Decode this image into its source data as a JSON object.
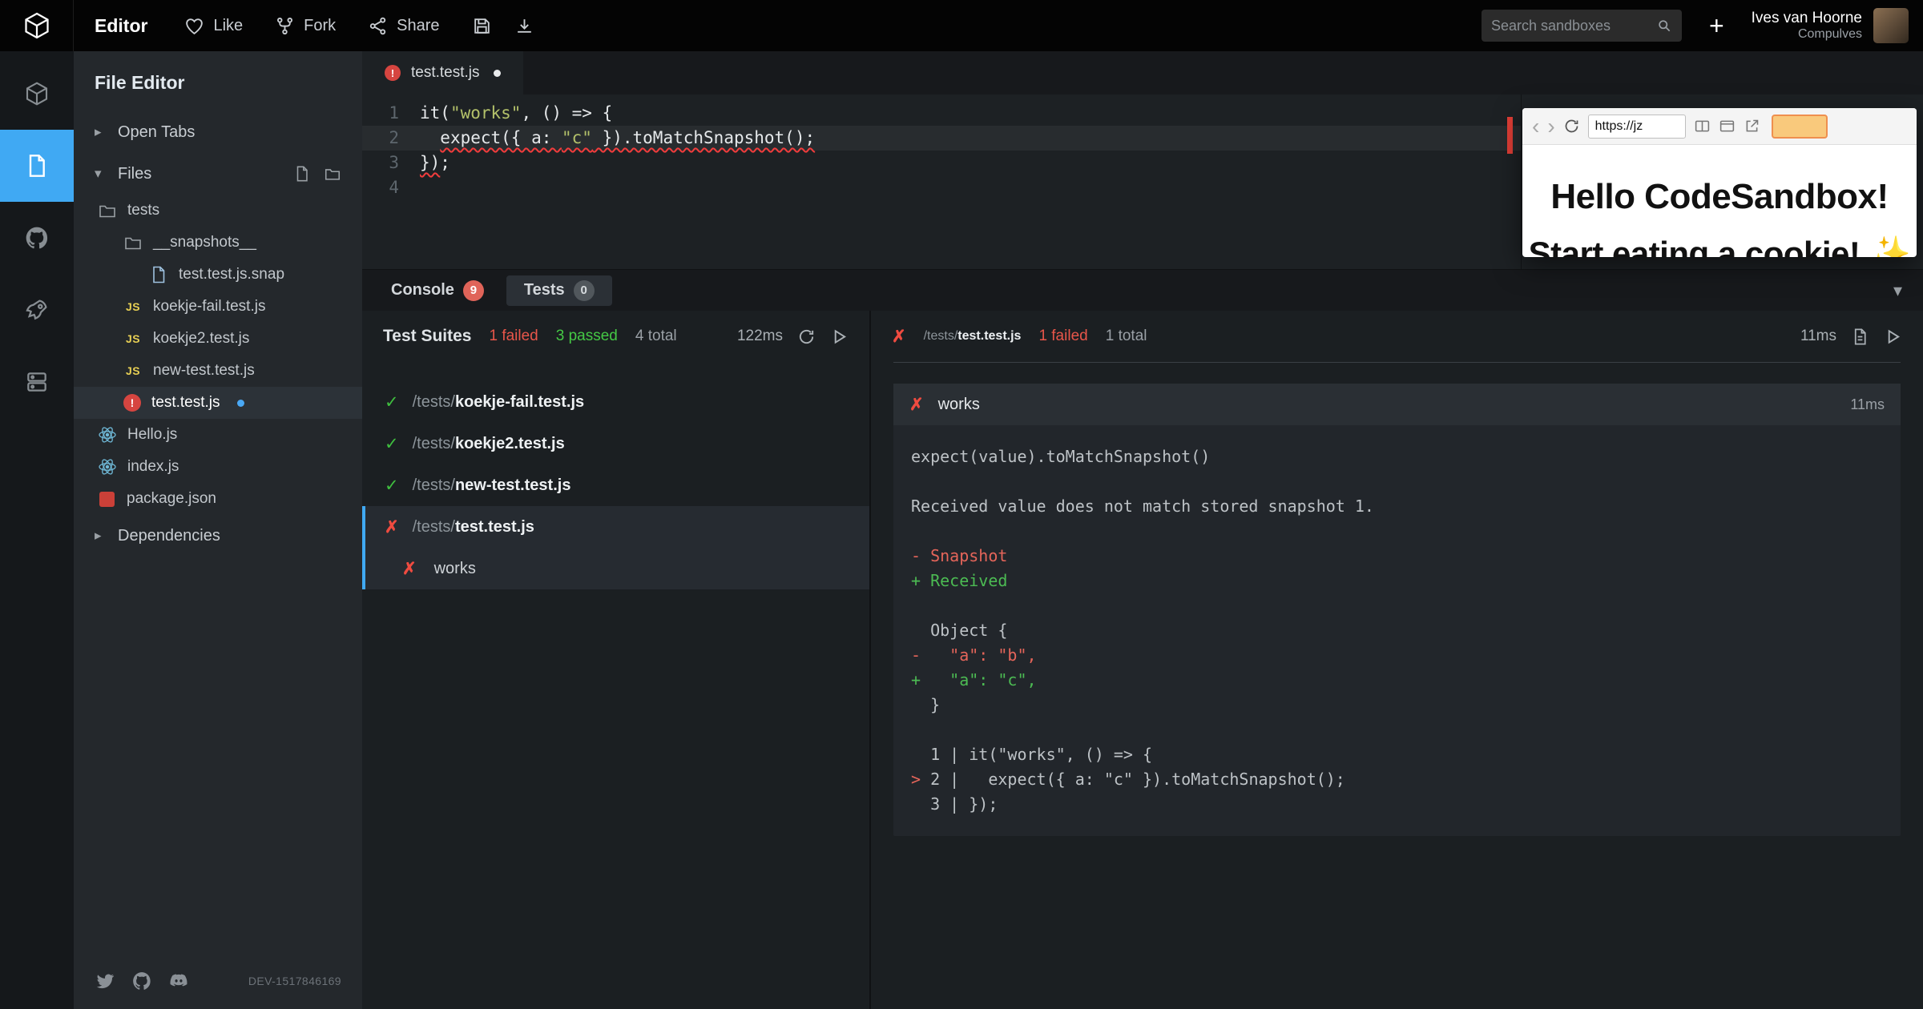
{
  "topbar": {
    "app_title": "Editor",
    "like_label": "Like",
    "fork_label": "Fork",
    "share_label": "Share",
    "search_placeholder": "Search sandboxes",
    "plus_label": "+",
    "user_name": "Ives van Hoorne",
    "user_team": "Compulves"
  },
  "sidebar": {
    "title": "File Editor",
    "open_tabs_label": "Open Tabs",
    "files_label": "Files",
    "dependencies_label": "Dependencies",
    "dev_id": "DEV-1517846169",
    "tree": [
      {
        "label": "tests",
        "icon": "folder",
        "depth": 0
      },
      {
        "label": "__snapshots__",
        "icon": "folder",
        "depth": 1
      },
      {
        "label": "test.test.js.snap",
        "icon": "file",
        "depth": 2
      },
      {
        "label": "koekje-fail.test.js",
        "icon": "js",
        "depth": 1
      },
      {
        "label": "koekje2.test.js",
        "icon": "js",
        "depth": 1
      },
      {
        "label": "new-test.test.js",
        "icon": "js",
        "depth": 1
      },
      {
        "label": "test.test.js",
        "icon": "error",
        "depth": 1,
        "selected": true,
        "modified": true
      },
      {
        "label": "Hello.js",
        "icon": "react",
        "depth": 0
      },
      {
        "label": "index.js",
        "icon": "react",
        "depth": 0
      },
      {
        "label": "package.json",
        "icon": "npm",
        "depth": 0
      }
    ]
  },
  "editor": {
    "tab_label": "test.test.js",
    "lines": [
      {
        "num": "1",
        "tokens": [
          {
            "t": "it(",
            "c": "plain"
          },
          {
            "t": "\"works\"",
            "c": "string"
          },
          {
            "t": ", () => {",
            "c": "plain"
          }
        ]
      },
      {
        "num": "2",
        "active": true,
        "tokens": [
          {
            "t": "  ",
            "c": "plain"
          },
          {
            "t": "expect({ a: ",
            "c": "plain",
            "u": true
          },
          {
            "t": "\"c\"",
            "c": "string",
            "u": true
          },
          {
            "t": " }).toMatchSnapshot();",
            "c": "plain",
            "u": true
          }
        ]
      },
      {
        "num": "3",
        "tokens": [
          {
            "t": "})",
            "c": "plain",
            "u": true
          },
          {
            "t": ";",
            "c": "plain"
          }
        ]
      },
      {
        "num": "4",
        "tokens": []
      }
    ]
  },
  "panel": {
    "tabs": [
      {
        "label": "Console",
        "badge": "9",
        "badge_type": "red",
        "active": false
      },
      {
        "label": "Tests",
        "badge": "0",
        "badge_type": "gray",
        "active": true
      }
    ],
    "suites": {
      "title": "Test Suites",
      "failed": "1 failed",
      "passed": "3 passed",
      "total": "4 total",
      "duration": "122ms",
      "items": [
        {
          "status": "pass",
          "dir": "/tests/",
          "name": "koekje-fail.test.js"
        },
        {
          "status": "pass",
          "dir": "/tests/",
          "name": "koekje2.test.js"
        },
        {
          "status": "pass",
          "dir": "/tests/",
          "name": "new-test.test.js"
        },
        {
          "status": "fail",
          "dir": "/tests/",
          "name": "test.test.js",
          "selected": true
        },
        {
          "status": "fail",
          "name": "works",
          "child": true,
          "selected": true
        }
      ]
    },
    "details": {
      "dir": "/tests/",
      "file": "test.test.js",
      "failed": "1 failed",
      "total": "1 total",
      "duration": "11ms",
      "test": {
        "name": "works",
        "duration": "11ms"
      },
      "output": [
        [
          {
            "t": "expect(value).toMatchSnapshot()",
            "c": "plain"
          }
        ],
        [],
        [
          {
            "t": "Received value does not match stored snapshot 1.",
            "c": "plain"
          }
        ],
        [],
        [
          {
            "t": "- Snapshot",
            "c": "red"
          }
        ],
        [
          {
            "t": "+ Received",
            "c": "green"
          }
        ],
        [],
        [
          {
            "t": "  Object {",
            "c": "plain"
          }
        ],
        [
          {
            "t": "-   \"a\": \"b\",",
            "c": "red"
          }
        ],
        [
          {
            "t": "+   \"a\": \"c\",",
            "c": "green"
          }
        ],
        [
          {
            "t": "  }",
            "c": "plain"
          }
        ],
        [],
        [
          {
            "t": "  1 | it(\"works\", () => {",
            "c": "plain"
          }
        ],
        [
          {
            "t": ">",
            "c": "red"
          },
          {
            "t": " 2 |   expect({ a: \"c\" }).toMatchSnapshot();",
            "c": "plain"
          }
        ],
        [
          {
            "t": "  3 | });",
            "c": "plain"
          }
        ]
      ]
    }
  },
  "preview": {
    "url": "https://jz",
    "heading": "Hello CodeSandbox!",
    "subheading": "Start eating a cookie! ✨"
  }
}
